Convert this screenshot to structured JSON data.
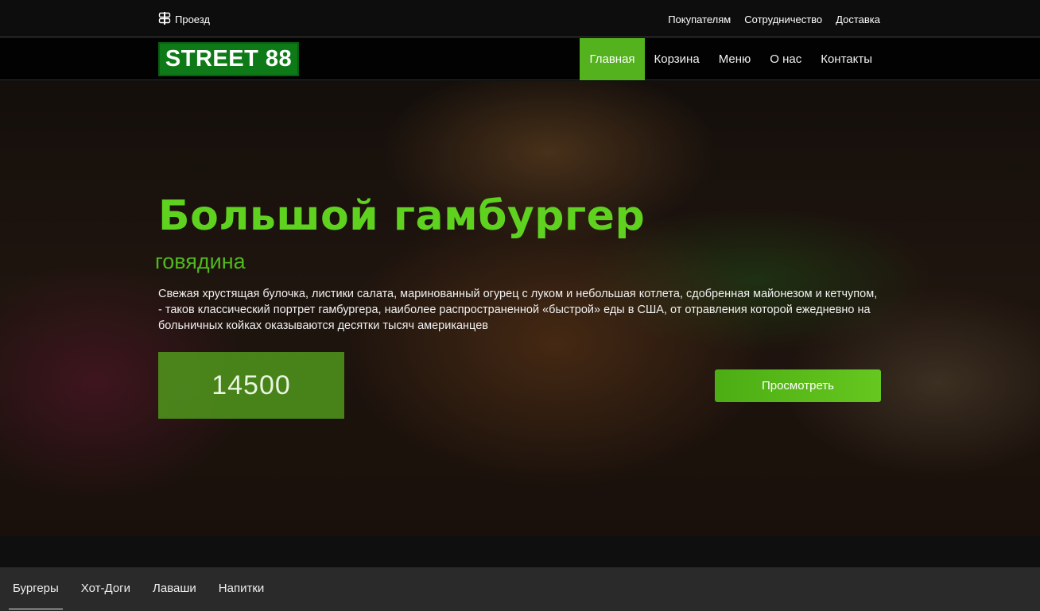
{
  "topbar": {
    "route_label": "Проезд",
    "route_icon": "signpost-icon",
    "links": [
      "Покупателям",
      "Сотрудничество",
      "Доставка"
    ]
  },
  "navbar": {
    "logo": "STREET 88",
    "menu": [
      {
        "label": "Главная",
        "active": true
      },
      {
        "label": "Корзина",
        "active": false
      },
      {
        "label": "Меню",
        "active": false
      },
      {
        "label": "О нас",
        "active": false
      },
      {
        "label": "Контакты",
        "active": false
      }
    ]
  },
  "hero": {
    "title": "Большой гамбургер",
    "subtitle": "говядина",
    "description": "Свежая хрустящая булочка, листики салата, маринованный огурец с луком и небольшая котлета, сдобренная майонезом и кетчупом, - таков классический портрет гамбургера, наиболее распространенной «быстрой» еды в США, от отравления которой ежедневно на больничных койках оказываются десятки тысяч американцев",
    "price": "14500",
    "button": "Просмотреть"
  },
  "category_tabs": [
    {
      "label": "Бургеры",
      "active": true
    },
    {
      "label": "Хот-Доги",
      "active": false
    },
    {
      "label": "Лаваши",
      "active": false
    },
    {
      "label": "Напитки",
      "active": false
    }
  ],
  "colors": {
    "accent": "#53b21e",
    "title_green": "#5fd11f",
    "logo_green": "#0d7a17"
  }
}
